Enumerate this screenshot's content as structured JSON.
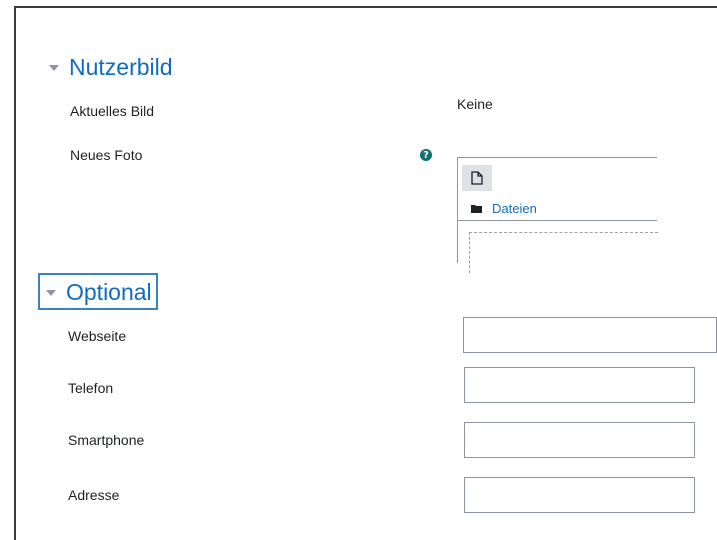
{
  "nutzerbild": {
    "title": "Nutzerbild",
    "aktuelles_bild_label": "Aktuelles Bild",
    "aktuelles_bild_value": "Keine",
    "neues_foto_label": "Neues Foto",
    "filepicker": {
      "folder_link": "Dateien"
    }
  },
  "optional": {
    "title": "Optional",
    "fields": [
      {
        "label": "Webseite",
        "value": ""
      },
      {
        "label": "Telefon",
        "value": ""
      },
      {
        "label": "Smartphone",
        "value": ""
      },
      {
        "label": "Adresse",
        "value": ""
      }
    ]
  },
  "icons": {
    "help": "question-circle-icon",
    "add_file": "file-icon",
    "folder": "folder-icon",
    "collapse": "caret-down-icon"
  },
  "colors": {
    "link": "#0f6cbf",
    "focus_outline": "#3b82c4",
    "help_icon": "#0f6e6e"
  }
}
